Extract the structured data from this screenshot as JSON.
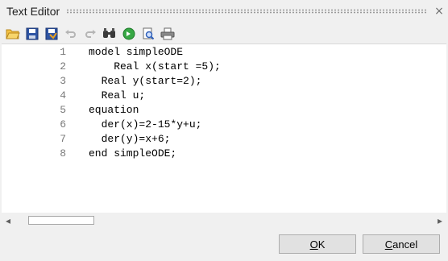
{
  "window": {
    "title": "Text Editor",
    "close_glyph": "×"
  },
  "toolbar": {
    "items": [
      {
        "name": "open-folder-icon",
        "color": "#e0a020"
      },
      {
        "name": "save-icon",
        "color": "#3a5fa8"
      },
      {
        "name": "save-all-icon",
        "color": "#3a5fa8"
      },
      {
        "name": "undo-icon",
        "color": "#b8b8b8"
      },
      {
        "name": "redo-icon",
        "color": "#b8b8b8"
      },
      {
        "name": "find-icon",
        "color": "#444444"
      },
      {
        "name": "goto-icon",
        "color": "#2a9d3a"
      },
      {
        "name": "print-preview-icon",
        "color": "#3a6ac0"
      },
      {
        "name": "print-icon",
        "color": "#555555"
      }
    ]
  },
  "editor": {
    "lines": [
      {
        "number": "1",
        "text": "model simpleODE"
      },
      {
        "number": "2",
        "text": "    Real x(start =5);"
      },
      {
        "number": "3",
        "text": "  Real y(start=2);"
      },
      {
        "number": "4",
        "text": "  Real u;"
      },
      {
        "number": "5",
        "text": "equation"
      },
      {
        "number": "6",
        "text": "  der(x)=2-15*y+u;"
      },
      {
        "number": "7",
        "text": "  der(y)=x+6;"
      },
      {
        "number": "8",
        "text": "end simpleODE;"
      }
    ]
  },
  "scrollbar": {
    "left_arrow": "◂",
    "right_arrow": "▸"
  },
  "buttons": {
    "ok_mnemonic": "O",
    "ok_rest": "K",
    "cancel_mnemonic": "C",
    "cancel_rest": "ancel"
  }
}
